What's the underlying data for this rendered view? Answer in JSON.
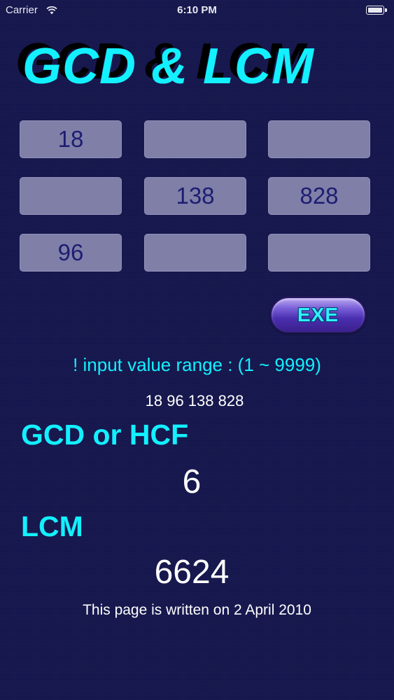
{
  "status_bar": {
    "carrier": "Carrier",
    "time": "6:10 PM",
    "wifi_icon": "wifi-icon",
    "battery_icon": "battery-icon",
    "battery_level": 1.0
  },
  "app": {
    "title": "GCD & LCM"
  },
  "inputs": [
    {
      "value": "18"
    },
    {
      "value": ""
    },
    {
      "value": ""
    },
    {
      "value": ""
    },
    {
      "value": "138"
    },
    {
      "value": "828"
    },
    {
      "value": "96"
    },
    {
      "value": ""
    },
    {
      "value": ""
    }
  ],
  "exe_button": {
    "label": "EXE"
  },
  "range_note": "! input value range : (1 ~ 9999)",
  "input_echo": "18 96 138 828",
  "gcd": {
    "label": "GCD or HCF",
    "value": "6"
  },
  "lcm": {
    "label": "LCM",
    "value": "6624"
  },
  "footer": "This page is written on 2 April 2010",
  "colors": {
    "background": "#16174e",
    "accent_cyan": "#13f0ff",
    "field_bg": "#7f7fa8",
    "field_text": "#1d1d72",
    "button_purple": "#4a2fb0"
  }
}
